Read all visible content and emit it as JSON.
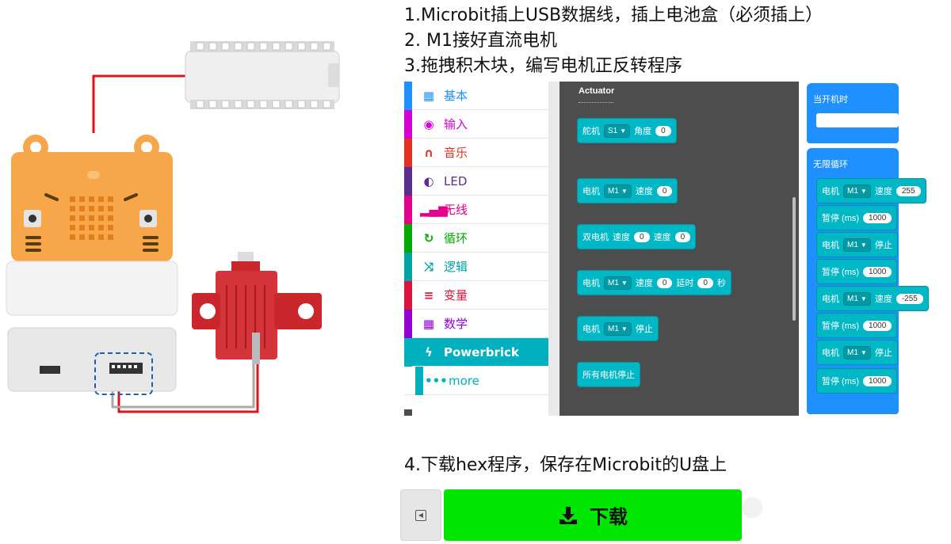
{
  "steps": {
    "s1": "1.Microbit插上USB数据线，插上电池盒（必须插上）",
    "s2": "2. M1接好直流电机",
    "s3": "3.拖拽积木块，编写电机正反转程序",
    "s4": "4.下载hex程序，保存在Microbit的U盘上"
  },
  "toolbox": {
    "categories": [
      {
        "label": "基本",
        "color": "#1e90ff",
        "icon": "grid-icon"
      },
      {
        "label": "输入",
        "color": "#d400d4",
        "icon": "target-icon"
      },
      {
        "label": "音乐",
        "color": "#e63022",
        "icon": "headphones-icon"
      },
      {
        "label": "LED",
        "color": "#5c2d91",
        "icon": "toggle-icon"
      },
      {
        "label": "无线",
        "color": "#e3008c",
        "icon": "signal-icon"
      },
      {
        "label": "循环",
        "color": "#00aa00",
        "icon": "refresh-icon"
      },
      {
        "label": "逻辑",
        "color": "#00a4a6",
        "icon": "shuffle-icon"
      },
      {
        "label": "变量",
        "color": "#dc143c",
        "icon": "lines-icon"
      },
      {
        "label": "数学",
        "color": "#9400d3",
        "icon": "calculator-icon"
      },
      {
        "label": "Powerbrick",
        "color": "#00b0bf",
        "icon": "bolt-icon"
      },
      {
        "label": "more",
        "color": "#00b0bf",
        "icon": "dots-icon"
      }
    ]
  },
  "flyout": {
    "title": "Actuator",
    "servo": {
      "name": "舵机",
      "port": "S1",
      "angle_label": "角度",
      "angle": "0"
    },
    "motor_speed": {
      "name": "电机",
      "port": "M1",
      "speed_label": "速度",
      "speed": "0"
    },
    "dual_motor": {
      "name": "双电机",
      "speed_label": "速度",
      "speed1": "0",
      "speed2": "0"
    },
    "motor_delay": {
      "name": "电机",
      "port": "M1",
      "speed_label": "速度",
      "speed": "0",
      "delay_label": "延时",
      "delay": "0",
      "unit": "秒"
    },
    "motor_stop": {
      "name": "电机",
      "port": "M1",
      "stop": "停止"
    },
    "stop_all": "所有电机停止"
  },
  "workspace": {
    "on_start": "当开机时",
    "forever": "无限循环",
    "motor1": {
      "name": "电机",
      "port": "M1",
      "speed_label": "速度",
      "speed": "255"
    },
    "pause1": {
      "label": "暂停 (ms)",
      "value": "1000"
    },
    "stop1": {
      "name": "电机",
      "port": "M1",
      "stop": "停止"
    },
    "pause2": {
      "label": "暂停 (ms)",
      "value": "1000"
    },
    "motor2": {
      "name": "电机",
      "port": "M1",
      "speed_label": "速度",
      "speed": "-255"
    },
    "pause3": {
      "label": "暂停 (ms)",
      "value": "1000"
    },
    "stop2": {
      "name": "电机",
      "port": "M1",
      "stop": "停止"
    },
    "pause4": {
      "label": "暂停 (ms)",
      "value": "1000"
    }
  },
  "download": {
    "label": "下载"
  },
  "colors": {
    "block": "#00b7c6",
    "flyout": "#4d4d4d",
    "download": "#00e600",
    "hat": "#1e90ff"
  }
}
